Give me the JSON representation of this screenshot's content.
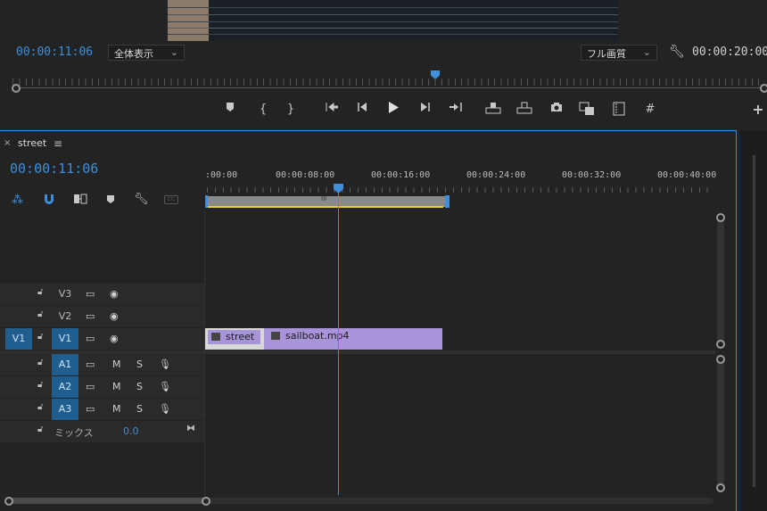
{
  "program_monitor": {
    "current_timecode": "00:00:11:06",
    "zoom_select": "全体表示",
    "quality_select": "フル画質",
    "duration_timecode": "00:00:20:00"
  },
  "transport_icons": [
    "marker-icon",
    "in-point-icon",
    "out-point-icon",
    "go-to-in-icon",
    "step-back-icon",
    "play-icon",
    "step-forward-icon",
    "go-to-out-icon",
    "lift-icon",
    "extract-icon",
    "export-frame-icon",
    "comparison-view-icon",
    "proxy-toggle-icon",
    "safe-margins-icon",
    "add-button-icon"
  ],
  "timeline": {
    "tab_title": "street",
    "close_glyph": "×",
    "menu_glyph": "≡",
    "timecode": "00:00:11:06",
    "ruler_labels": [
      ":00:00",
      "00:00:08:00",
      "00:00:16:00",
      "00:00:24:00",
      "00:00:32:00",
      "00:00:40:00"
    ],
    "video_tracks": [
      {
        "name": "V3",
        "target": false,
        "source": ""
      },
      {
        "name": "V2",
        "target": false,
        "source": ""
      },
      {
        "name": "V1",
        "target": true,
        "source": "V1"
      }
    ],
    "audio_tracks": [
      {
        "name": "A1",
        "mute": "M",
        "solo": "S"
      },
      {
        "name": "A2",
        "mute": "M",
        "solo": "S"
      },
      {
        "name": "A3",
        "mute": "M",
        "solo": "S"
      }
    ],
    "mix": {
      "label": "ミックス",
      "value": "0.0"
    },
    "clips": [
      {
        "name": "street"
      },
      {
        "name": "sailboat.mp4"
      }
    ],
    "workarea_grip": "III"
  },
  "colors": {
    "accent_blue": "#3d8fdb",
    "clip_purple": "#a894d8",
    "track_target": "#1f5e8f",
    "workarea_yellow": "#e6d12a"
  }
}
